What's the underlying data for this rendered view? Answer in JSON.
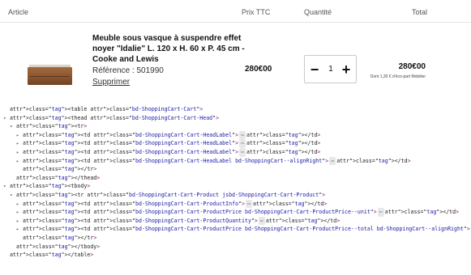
{
  "cart": {
    "headers": {
      "article": "Article",
      "prix": "Prix TTC",
      "quantite": "Quantité",
      "total": "Total"
    },
    "product": {
      "name": "Meuble sous vasque à suspendre effet noyer \"Idalie\" L. 120 x H. 60 x P. 45 cm - Cooke and Lewis",
      "reference": "Référence : 501990",
      "remove": "Supprimer",
      "unit_price": "280€00",
      "quantity": "1",
      "minus": "−",
      "plus": "+",
      "total": "280€00",
      "eco_part": "Dont 1,30 € d'éco-part Mobilier"
    }
  },
  "devtools": {
    "lines": [
      {
        "indent": 0,
        "tri": "",
        "html": "<table class=\"bd-ShoppingCart-Cart\">"
      },
      {
        "indent": 0,
        "tri": "▾",
        "html": "<thead class=\"bd-ShoppingCart-Cart-Head\">"
      },
      {
        "indent": 1,
        "tri": "▾",
        "html": "<tr>"
      },
      {
        "indent": 2,
        "tri": "▸",
        "html": "<td class=\"bd-ShoppingCart-Cart-HeadLabel\">",
        "ell": true,
        "close": "</td>"
      },
      {
        "indent": 2,
        "tri": "▸",
        "html": "<td class=\"bd-ShoppingCart-Cart-HeadLabel\">",
        "ell": true,
        "close": "</td>"
      },
      {
        "indent": 2,
        "tri": "▸",
        "html": "<td class=\"bd-ShoppingCart-Cart-HeadLabel\">",
        "ell": true,
        "close": "</td>"
      },
      {
        "indent": 2,
        "tri": "▸",
        "html": "<td class=\"bd-ShoppingCart-Cart-HeadLabel bd-ShoppingCart--alignRight\">",
        "ell": true,
        "close": "</td>"
      },
      {
        "indent": 2,
        "tri": "",
        "html": "</tr>"
      },
      {
        "indent": 1,
        "tri": "",
        "html": "</thead>"
      },
      {
        "indent": 0,
        "tri": "▾",
        "html": "<tbody>"
      },
      {
        "indent": 1,
        "tri": "▾",
        "html": "<tr class=\"bd-ShoppingCart-Cart-Product jsbd-ShoppingCart-Cart-Product\">"
      },
      {
        "indent": 2,
        "tri": "▸",
        "html": "<td class=\"bd-ShoppingCart-Cart-ProductInfo\">",
        "ell": true,
        "close": "</td>"
      },
      {
        "indent": 2,
        "tri": "▸",
        "html": "<td class=\"bd-ShoppingCart-Cart-ProductPrice bd-ShoppingCart-Cart-ProductPrice--unit\">",
        "ell": true,
        "close": "</td>"
      },
      {
        "indent": 2,
        "tri": "▸",
        "html": "<td class=\"bd-ShoppingCart-Cart-ProductQuantity\">",
        "ell": true,
        "close": "</td>"
      },
      {
        "indent": 2,
        "tri": "▸",
        "html": "<td class=\"bd-ShoppingCart-Cart-ProductPrice bd-ShoppingCart-Cart-ProductPrice--total bd-ShoppingCart--alignRight\">",
        "ell": true,
        "close": "</td>"
      },
      {
        "indent": 2,
        "tri": "",
        "html": "</tr>"
      },
      {
        "indent": 1,
        "tri": "",
        "html": "</tbody>"
      },
      {
        "indent": 0,
        "tri": "",
        "html": "</table>"
      }
    ],
    "ellipsis": "⋯"
  }
}
